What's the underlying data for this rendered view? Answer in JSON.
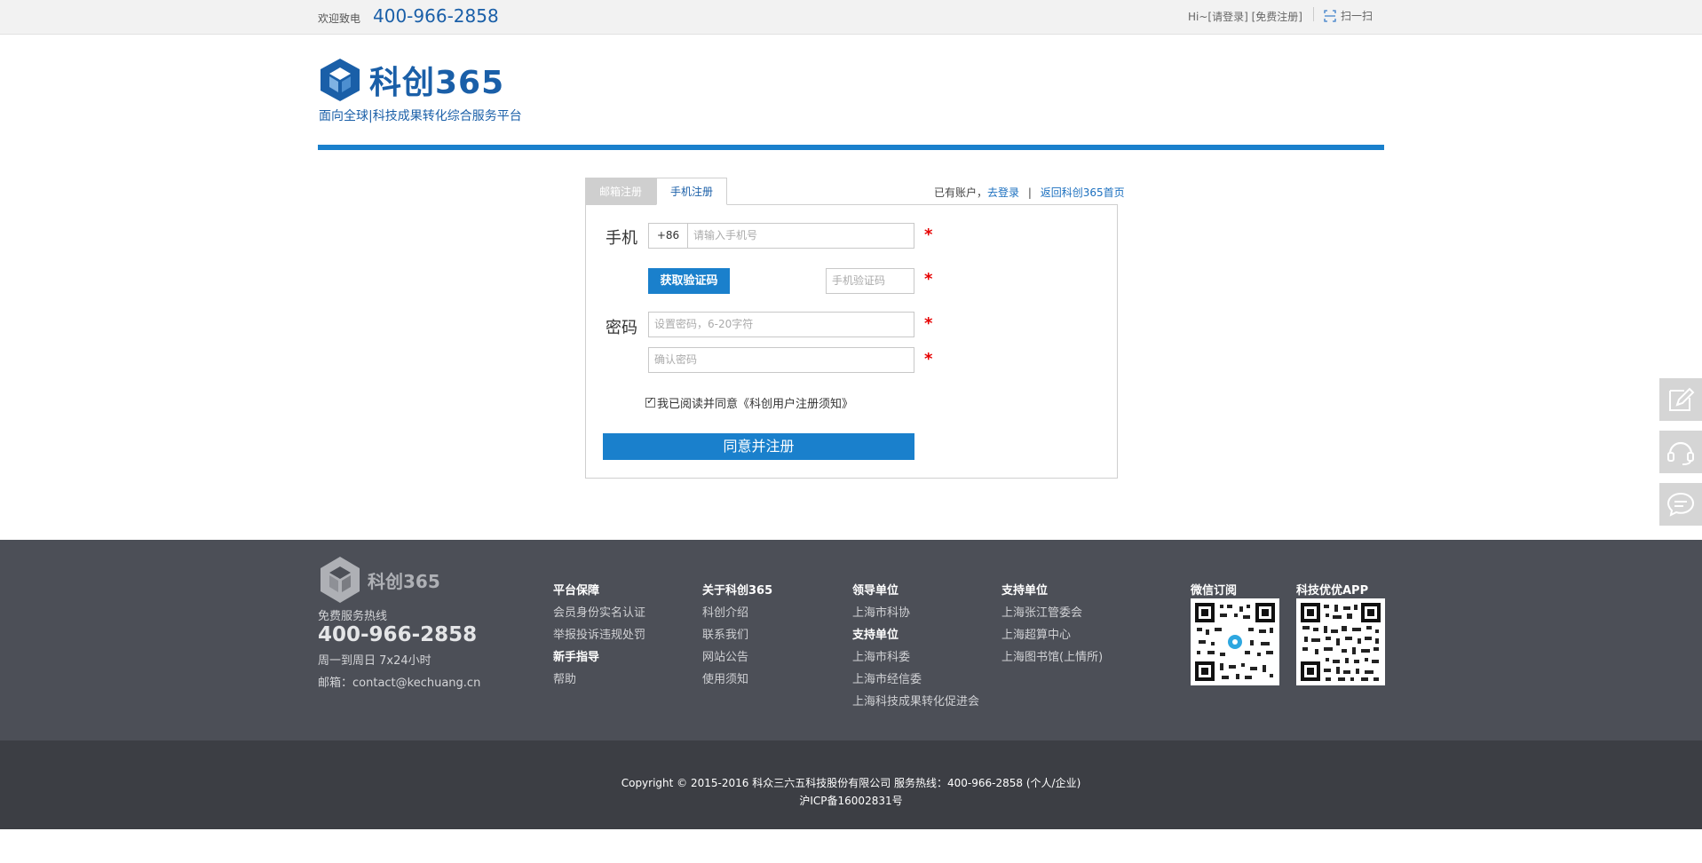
{
  "topbar": {
    "welcome": "欢迎致电",
    "phone": "400-966-2858",
    "login": "Hi~[请登录]",
    "register": "[免费注册]",
    "scan": "扫一扫"
  },
  "header": {
    "brand": "科创365",
    "slogan": "面向全球|科技成果转化综合服务平台"
  },
  "register": {
    "tabs": [
      "邮箱注册",
      "手机注册"
    ],
    "have_account": "已有账户，",
    "go_login": "去登录",
    "separator": "|",
    "back_home": "返回科创365首页",
    "phone_label": "手机",
    "country_code": "+86",
    "phone_placeholder": "请输入手机号",
    "get_code": "获取验证码",
    "code_placeholder": "手机验证码",
    "password_label": "密码",
    "password_placeholder": "设置密码，6-20字符",
    "confirm_placeholder": "确认密码",
    "required": "*",
    "agree_text": "我已阅读并同意《科创用户注册须知》",
    "submit": "同意并注册"
  },
  "footer": {
    "brand": "科创365",
    "hotline_label": "免费服务热线",
    "hotline": "400-966-2858",
    "hours": "周一到周日 7x24小时",
    "email": "邮箱：contact@kechuang.cn",
    "col1": {
      "title1": "平台保障",
      "link1": "会员身份实名认证",
      "link2": "举报投诉违规处罚",
      "title2": "新手指导",
      "link3": "帮助"
    },
    "col2": {
      "title": "关于科创365",
      "link1": "科创介绍",
      "link2": "联系我们",
      "link3": "网站公告",
      "link4": "使用须知"
    },
    "col3": {
      "title1": "领导单位",
      "link1": "上海市科协",
      "title2": "支持单位",
      "link2": "上海市科委",
      "link3": "上海市经信委",
      "link4": "上海科技成果转化促进会"
    },
    "col4": {
      "title": "支持单位",
      "link1": "上海张江管委会",
      "link2": "上海超算中心",
      "link3": "上海图书馆(上情所)"
    },
    "qr1_title": "微信订阅",
    "qr2_title": "科技优优APP",
    "copyright": "Copyright © 2015-2016 科众三六五科技股份有限公司 服务热线：400-966-2858 (个人/企业)",
    "icp": "沪ICP备16002831号"
  },
  "colors": {
    "brand_blue": "#1a5fa8",
    "accent_blue": "#1a80cc",
    "required_red": "#e60000",
    "footer_bg": "#4c4f57",
    "footer_bottom_bg": "#3c3e44"
  }
}
